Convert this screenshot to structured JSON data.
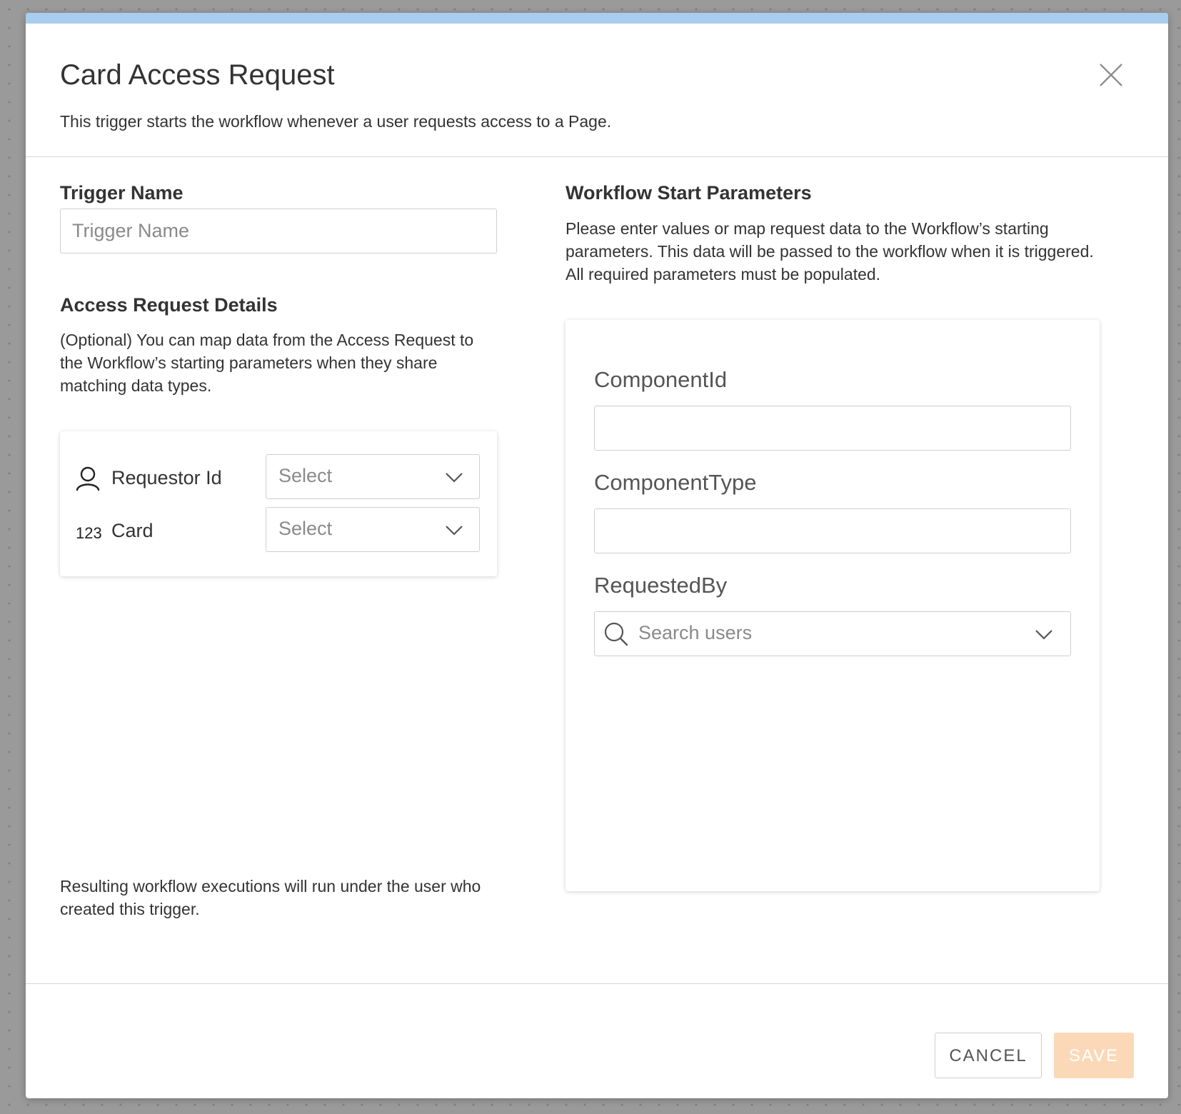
{
  "dialog": {
    "title": "Card Access Request",
    "subtitle": "This trigger starts the workflow whenever a user requests access to a Page."
  },
  "trigger_name": {
    "heading": "Trigger Name",
    "placeholder": "Trigger Name",
    "value": ""
  },
  "access_request": {
    "heading": "Access Request Details",
    "description": "(Optional) You can map data from the Access Request to the Workflow’s starting parameters when they share matching data types.",
    "rows": [
      {
        "icon": "user-icon",
        "label": "Requestor Id",
        "select": "Select"
      },
      {
        "icon": "number-icon",
        "icon_text": "123",
        "label": "Card",
        "select": "Select"
      }
    ]
  },
  "footer_note": "Resulting workflow executions will run under the user who created this trigger.",
  "workflow_params": {
    "heading": "Workflow Start Parameters",
    "description": "Please enter values or map request data to the Workflow’s starting parameters. This data will be passed to the workflow when it is triggered. All required parameters must be populated.",
    "params": [
      {
        "label": "ComponentId",
        "value": ""
      },
      {
        "label": "ComponentType",
        "value": ""
      },
      {
        "label": "RequestedBy",
        "placeholder": "Search users"
      }
    ]
  },
  "buttons": {
    "cancel": "CANCEL",
    "save": "SAVE"
  },
  "colors": {
    "accent_bar": "#a8cdef",
    "save_disabled": "#fbd9b8",
    "text": "#333333",
    "placeholder": "#8a8a8a",
    "border": "#cfcfcf"
  }
}
